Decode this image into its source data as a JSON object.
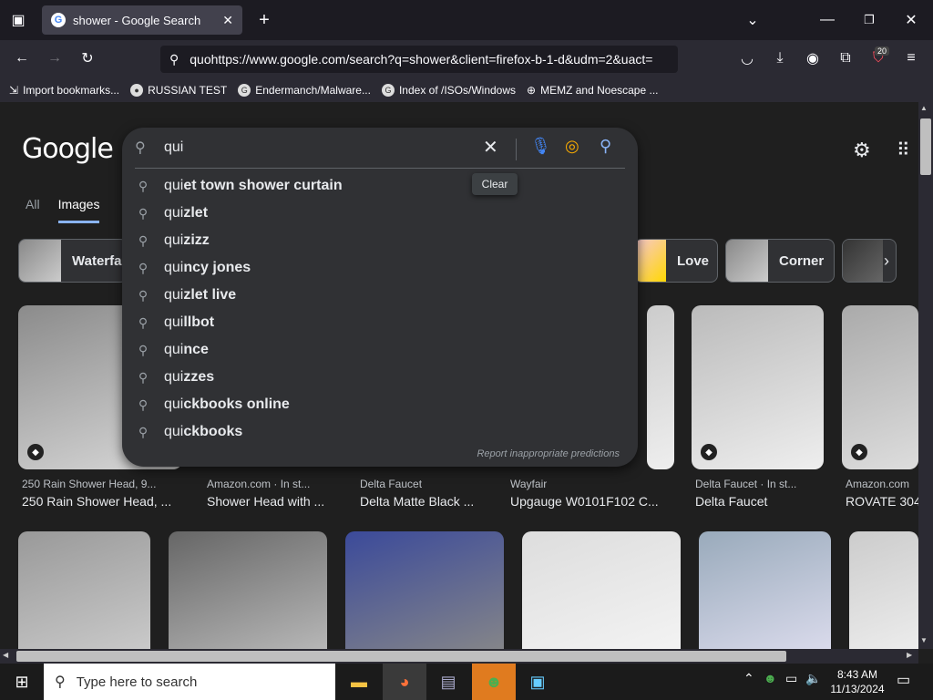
{
  "browser": {
    "tab_title": "shower - Google Search",
    "url": "quohttps://www.google.com/search?q=shower&client=firefox-b-1-d&udm=2&uact=",
    "extensions_badge": "20",
    "bookmarks": [
      {
        "label": "Import bookmarks..."
      },
      {
        "label": "RUSSIAN TEST"
      },
      {
        "label": "Endermanch/Malware..."
      },
      {
        "label": "Index of /ISOs/Windows"
      },
      {
        "label": "MEMZ and Noescape ..."
      }
    ]
  },
  "google": {
    "logo": "Google",
    "tabs": [
      {
        "label": "All"
      },
      {
        "label": "Images"
      }
    ],
    "chips": [
      {
        "label": "Waterfal"
      },
      {
        "label": "Love"
      },
      {
        "label": "Corner"
      }
    ],
    "search": {
      "query": "qui",
      "clear_tooltip": "Clear",
      "suggestions": [
        {
          "prefix": "qui",
          "rest": "et town shower curtain"
        },
        {
          "prefix": "qui",
          "rest": "zlet"
        },
        {
          "prefix": "qui",
          "rest": "zizz"
        },
        {
          "prefix": "qui",
          "rest": "ncy jones"
        },
        {
          "prefix": "qui",
          "rest": "zlet live"
        },
        {
          "prefix": "qui",
          "rest": "llbot"
        },
        {
          "prefix": "qui",
          "rest": "nce"
        },
        {
          "prefix": "qui",
          "rest": "zzes"
        },
        {
          "prefix": "qui",
          "rest": "ckbooks online"
        },
        {
          "prefix": "qui",
          "rest": "ckbooks"
        }
      ],
      "report": "Report inappropriate predictions"
    },
    "results": [
      {
        "source": "250 Rain Shower Head, 9...",
        "title": "250 Rain Shower Head, ..."
      },
      {
        "source": "Amazon.com · In st...",
        "title": "Shower Head with ..."
      },
      {
        "source": "Delta Faucet",
        "title": "Delta Matte Black ..."
      },
      {
        "source": "Wayfair",
        "title": "Upgauge W0101F102 C..."
      },
      {
        "source": "Delta Faucet · In st...",
        "title": "Delta Faucet"
      },
      {
        "source": "Amazon.com",
        "title": "ROVATE 304"
      }
    ]
  },
  "taskbar": {
    "search_placeholder": "Type here to search",
    "time": "8:43 AM",
    "date": "11/13/2024"
  }
}
